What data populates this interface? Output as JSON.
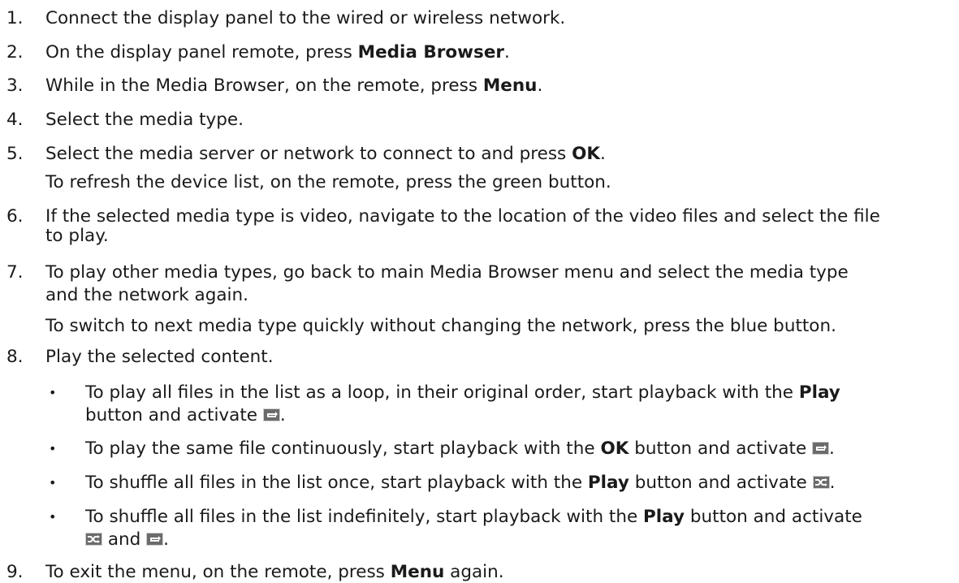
{
  "steps": [
    {
      "num": "1.",
      "text": "Connect the display panel to the wired or wireless network."
    },
    {
      "num": "2.",
      "pre": "On the display panel remote, press ",
      "bold": "Media Browser",
      "post": "."
    },
    {
      "num": "3.",
      "pre": "While in the Media Browser, on the remote, press ",
      "bold": "Menu",
      "post": "."
    },
    {
      "num": "4.",
      "text": "Select the media type."
    },
    {
      "num": "5.",
      "pre": "Select the media server or network to connect to and press ",
      "bold": "OK",
      "post": ".",
      "note": "To refresh the device list, on the remote, press the green button."
    },
    {
      "num": "6.",
      "line1": "If the selected media type is video, navigate to the location of the video files and select the file",
      "line2": "to play."
    },
    {
      "num": "7.",
      "line1": "To play other media types, go back to main Media Browser menu and select the media type",
      "line2": "and the network again.",
      "note": "To switch to next media type quickly without changing the network, press the blue button."
    },
    {
      "num": "8.",
      "text": "Play the selected content."
    },
    {
      "num": "9.",
      "pre": "To exit the menu, on the remote, press ",
      "bold": "Menu",
      "post": " again."
    }
  ],
  "bullets": [
    {
      "pre": "To play all files in the list as a loop, in their original order, start playback with the ",
      "bold": "Play",
      "line2_pre": "button and activate ",
      "post": "."
    },
    {
      "pre": "To play the same file continuously, start playback with the ",
      "bold": "OK",
      "mid": " button and activate ",
      "post": "."
    },
    {
      "pre": "To shuffle all files in the list once, start playback with the ",
      "bold": "Play",
      "mid": " button and activate ",
      "post": "."
    },
    {
      "pre": "To shuffle all files in the list indefinitely, start playback with the ",
      "bold": "Play",
      "mid": " button and activate",
      "line2_mid": " and ",
      "post": "."
    }
  ],
  "bullet_char": "•",
  "icons": {
    "repeat": "repeat-icon",
    "shuffle": "shuffle-icon"
  }
}
